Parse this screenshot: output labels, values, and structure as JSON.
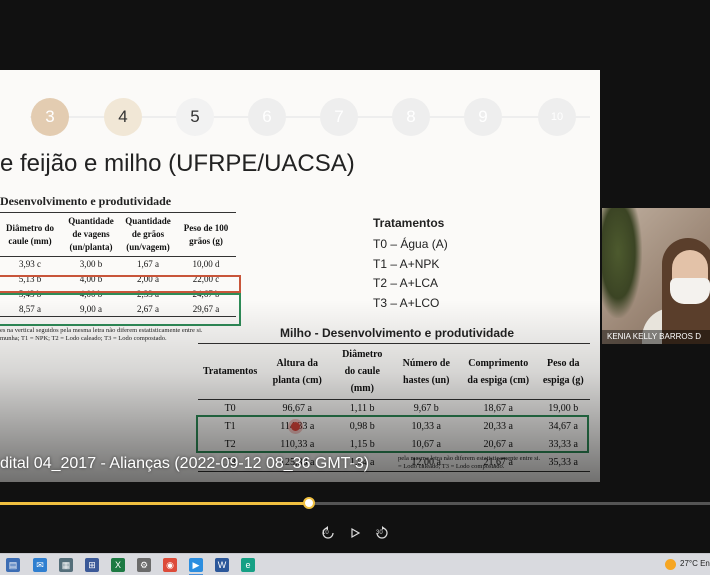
{
  "steps": [
    "3",
    "4",
    "5",
    "6",
    "7",
    "8",
    "9",
    "10"
  ],
  "slide": {
    "title": "e feijão e milho (UFRPE/UACSA)",
    "table1_title": "Desenvolvimento e produtividade",
    "table1": {
      "headers": [
        "Diâmetro do caule (mm)",
        "Quantidade de vagens (un/planta)",
        "Quantidade de grãos (un/vagem)",
        "Peso de 100 grãos (g)"
      ],
      "rows": [
        [
          "3,93 c",
          "3,00 b",
          "1,67 a",
          "10,00 d"
        ],
        [
          "5,13 b",
          "4,00 b",
          "2,00 a",
          "22,00 c"
        ],
        [
          "5,43 b",
          "4,00 b",
          "2,33 a",
          "24,67 b"
        ],
        [
          "8,57 a",
          "9,00 a",
          "2,67 a",
          "29,67 a"
        ]
      ],
      "note_line1": "es na vertical seguidos pela mesma letra não diferem estatisticamente entre si.",
      "note_line2": "munha; T1 = NPK; T2 = Lodo caleado; T3 = Lodo compostado."
    },
    "treatments_title": "Tratamentos",
    "treatments": [
      "T0 – Água (A)",
      "T1 – A+NPK",
      "T2 – A+LCA",
      "T3 – A+LCO"
    ],
    "table2_title": "Milho - Desenvolvimento e produtividade",
    "table2": {
      "headers": [
        "Tratamentos",
        "Altura da planta (cm)",
        "Diâmetro do caule (mm)",
        "Número de hastes (un)",
        "Comprimento da espiga (cm)",
        "Peso da espiga (g)"
      ],
      "rows": [
        [
          "T0",
          "96,67 a",
          "1,11 b",
          "9,67 b",
          "18,67 a",
          "19,00 b"
        ],
        [
          "T1",
          "114,33 a",
          "0,98 b",
          "10,33 a",
          "20,33 a",
          "34,67 a"
        ],
        [
          "T2",
          "110,33 a",
          "1,15 b",
          "10,67 a",
          "20,67 a",
          "33,33 a"
        ],
        [
          "T3",
          "125,33 a",
          "1,54 a",
          "12,00 a",
          "21,67 a",
          "35,33 a"
        ]
      ],
      "note_line1": "pela mesma letra não diferem estatisticamente entre si.",
      "note_line2": "= Lodo caleado; T3 = Lodo compostado."
    }
  },
  "video": {
    "title": "dital 04_2017 - Alianças  (2022-09-12 08_36 GMT-3)",
    "progress_fraction": 0.435,
    "rewind_label": "10",
    "forward_label": "30"
  },
  "webcam": {
    "name": "KENIA KELLY BARROS D"
  },
  "taskbar": {
    "temperature": "27°C  En"
  },
  "colors": {
    "accent_progress": "#f0c040",
    "highlight_red": "#c8553a",
    "highlight_green": "#2e8b57"
  }
}
